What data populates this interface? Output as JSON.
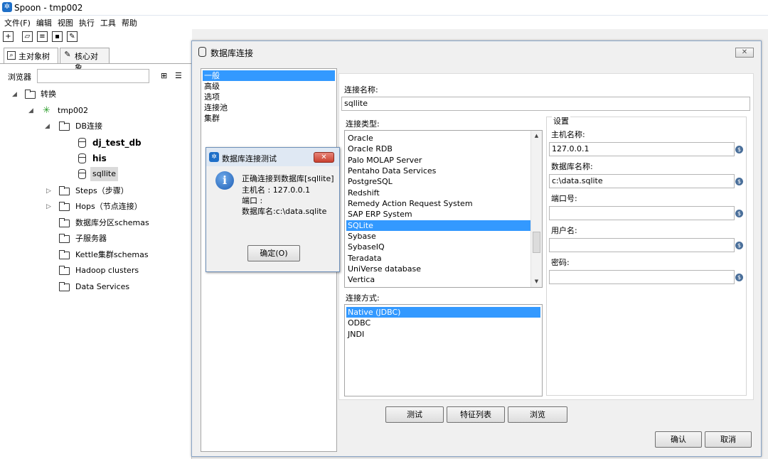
{
  "window": {
    "title": "Spoon - tmp002"
  },
  "menu": [
    "文件(F)",
    "编辑",
    "视图",
    "执行",
    "工具",
    "帮助"
  ],
  "left_tabs": {
    "main": "主对象树",
    "core": "核心对象"
  },
  "browser_label": "浏览器",
  "tree": {
    "transforms": "转换",
    "tmp": "tmp002",
    "db_conn": "DB连接",
    "db1": "dj_test_db",
    "db2": "his",
    "db3": "sqllite",
    "steps": "Steps（步骤）",
    "hops": "Hops（节点连接）",
    "partition": "数据库分区schemas",
    "subserver": "子服务器",
    "kettle_cluster": "Kettle集群schemas",
    "hadoop": "Hadoop clusters",
    "data_services": "Data Services"
  },
  "db_dialog": {
    "title": "数据库连接",
    "sections": [
      "一般",
      "高级",
      "选项",
      "连接池",
      "集群"
    ],
    "conn_name_label": "连接名称:",
    "conn_name_value": "sqllite",
    "conn_type_label": "连接类型:",
    "conn_types": [
      "Oracle",
      "Oracle RDB",
      "Palo MOLAP Server",
      "Pentaho Data Services",
      "PostgreSQL",
      "Redshift",
      "Remedy Action Request System",
      "SAP ERP System",
      "SQLite",
      "Sybase",
      "SybaseIQ",
      "Teradata",
      "UniVerse database",
      "Vertica"
    ],
    "access_label": "连接方式:",
    "access_types": [
      "Native (JDBC)",
      "ODBC",
      "JNDI"
    ],
    "settings_label": "设置",
    "host_label": "主机名称:",
    "host_value": "127.0.0.1",
    "dbname_label": "数据库名称:",
    "dbname_value": "c:\\data.sqlite",
    "port_label": "端口号:",
    "port_value": "",
    "user_label": "用户名:",
    "user_value": "",
    "password_label": "密码:",
    "password_value": "",
    "btn_test": "测试",
    "btn_features": "特征列表",
    "btn_explore": "浏览",
    "btn_ok": "确认",
    "btn_cancel": "取消"
  },
  "test_dialog": {
    "title": "数据库连接测试",
    "line1": "正确连接到数据库[sqllite]",
    "line2": "主机名      : 127.0.0.1",
    "line3": "端口         :",
    "line4": "数据库名:c:\\data.sqlite",
    "ok": "确定(O)"
  }
}
